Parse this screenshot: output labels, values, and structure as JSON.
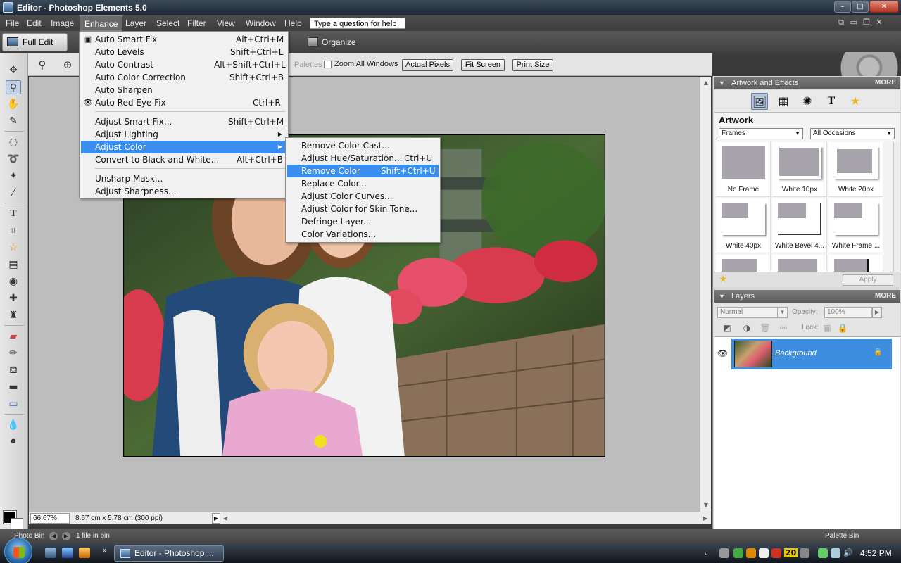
{
  "window": {
    "title": "Editor - Photoshop Elements 5.0",
    "min": "–",
    "max": "□",
    "close": "✕"
  },
  "menubar": {
    "items": [
      "File",
      "Edit",
      "Image",
      "Enhance",
      "Layer",
      "Select",
      "Filter",
      "View",
      "Window",
      "Help"
    ],
    "active": "Enhance",
    "help_placeholder": "Type a question for help",
    "icons": [
      "⧉",
      "▭",
      "❐",
      "✕"
    ]
  },
  "modebar": {
    "full_edit": "Full Edit",
    "organize": "Organize"
  },
  "options": {
    "palettes_label": "Palettes",
    "zoom_all_label": "Zoom All Windows",
    "buttons": [
      "Actual Pixels",
      "Fit Screen",
      "Print Size"
    ]
  },
  "enhance_menu": {
    "groups": [
      [
        {
          "label": "Auto Smart Fix",
          "shortcut": "Alt+Ctrl+M",
          "icon": "smart-fix-icon"
        },
        {
          "label": "Auto Levels",
          "shortcut": "Shift+Ctrl+L"
        },
        {
          "label": "Auto Contrast",
          "shortcut": "Alt+Shift+Ctrl+L"
        },
        {
          "label": "Auto Color Correction",
          "shortcut": "Shift+Ctrl+B"
        },
        {
          "label": "Auto Sharpen",
          "shortcut": ""
        },
        {
          "label": "Auto Red Eye Fix",
          "shortcut": "Ctrl+R",
          "icon": "eye-icon"
        }
      ],
      [
        {
          "label": "Adjust Smart Fix...",
          "shortcut": "Shift+Ctrl+M"
        },
        {
          "label": "Adjust Lighting",
          "shortcut": "",
          "submenu": true
        },
        {
          "label": "Adjust Color",
          "shortcut": "",
          "submenu": true,
          "highlighted": true
        },
        {
          "label": "Convert to Black and White...",
          "shortcut": "Alt+Ctrl+B"
        }
      ],
      [
        {
          "label": "Unsharp Mask...",
          "shortcut": ""
        },
        {
          "label": "Adjust Sharpness...",
          "shortcut": ""
        }
      ]
    ]
  },
  "adjust_color_submenu": {
    "items": [
      {
        "label": "Remove Color Cast...",
        "shortcut": ""
      },
      {
        "label": "Adjust Hue/Saturation...",
        "shortcut": "Ctrl+U"
      },
      {
        "label": "Remove Color",
        "shortcut": "Shift+Ctrl+U",
        "highlighted": true
      },
      {
        "label": "Replace Color...",
        "shortcut": ""
      },
      {
        "label": "Adjust Color Curves...",
        "shortcut": ""
      },
      {
        "label": "Adjust Color for Skin Tone...",
        "shortcut": ""
      },
      {
        "label": "Defringe Layer...",
        "shortcut": ""
      },
      {
        "label": "Color Variations...",
        "shortcut": ""
      }
    ]
  },
  "status": {
    "zoom": "66.67%",
    "doc_size": "8.67 cm x 5.78 cm (300 ppi)"
  },
  "binbar": {
    "photo_bin": "Photo Bin",
    "files": "1 file in bin",
    "palette_bin": "Palette Bin"
  },
  "artwork_panel": {
    "header": "Artwork and Effects",
    "more": "MORE",
    "title": "Artwork",
    "category": "Frames",
    "occasion": "All Occasions",
    "thumbnails": [
      {
        "label": "No Frame",
        "style": "none"
      },
      {
        "label": "White 10px",
        "style": "white10"
      },
      {
        "label": "White 20px",
        "style": "white20"
      },
      {
        "label": "White 40px",
        "style": "white40"
      },
      {
        "label": "White Bevel 4...",
        "style": "bevel"
      },
      {
        "label": "White Frame ...",
        "style": "frame"
      }
    ],
    "apply": "Apply"
  },
  "layers_panel": {
    "header": "Layers",
    "more": "MORE",
    "blend_mode": "Normal",
    "opacity_label": "Opacity:",
    "opacity_value": "100%",
    "lock_label": "Lock:",
    "layers": [
      {
        "name": "Background",
        "locked": true,
        "visible": true
      }
    ]
  },
  "taskbar": {
    "task": "Editor - Photoshop ...",
    "clock": "4:52 PM",
    "tray_badge": "20"
  }
}
